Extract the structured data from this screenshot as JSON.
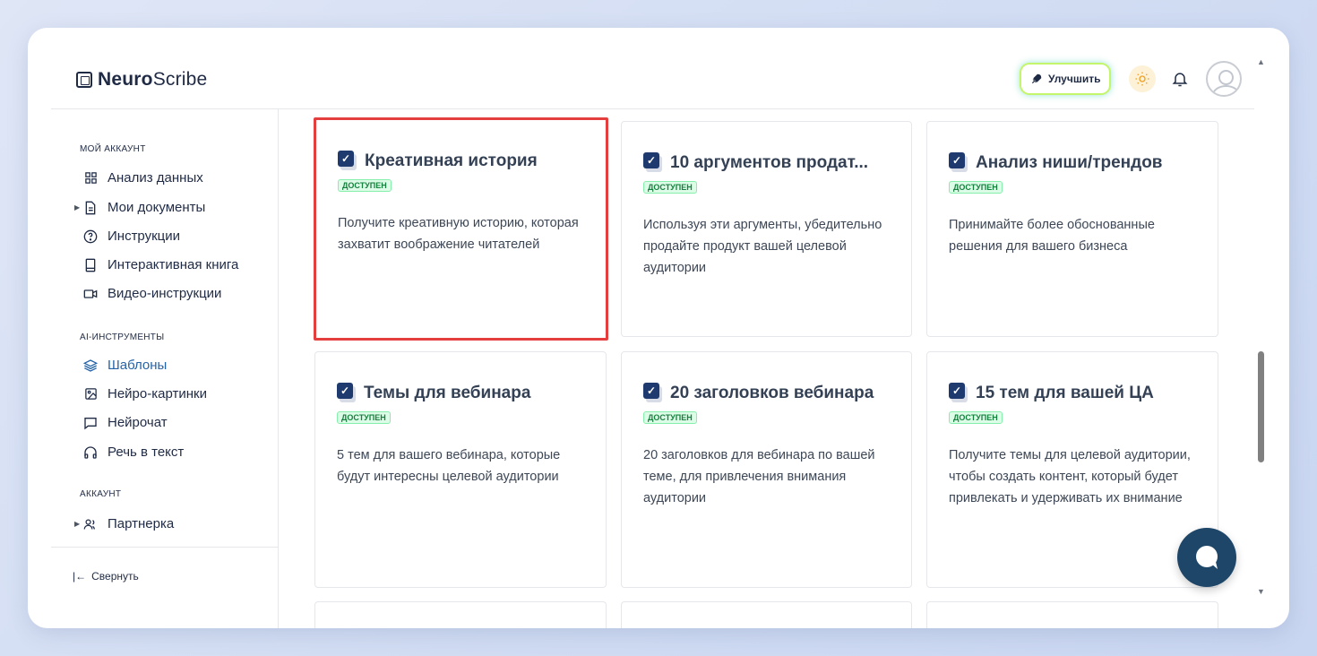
{
  "app": {
    "logo_bold": "Neuro",
    "logo_rest": "Scribe"
  },
  "header": {
    "upgrade_label": "Улучшить",
    "icons": [
      "rocket-icon",
      "sun-icon",
      "bell-icon",
      "user-avatar"
    ]
  },
  "sidebar": {
    "section_account": "МОЙ АККАУНТ",
    "items_account": [
      {
        "label": "Анализ данных",
        "icon": "grid-icon"
      },
      {
        "label": "Мои документы",
        "icon": "document-icon"
      },
      {
        "label": "Инструкции",
        "icon": "help-circle-icon"
      },
      {
        "label": "Интерактивная книга",
        "icon": "book-icon"
      },
      {
        "label": "Видео-инструкции",
        "icon": "video-icon"
      }
    ],
    "section_ai": "AI-ИНСТРУМЕНТЫ",
    "items_ai": [
      {
        "label": "Шаблоны",
        "icon": "layers-icon",
        "active": true
      },
      {
        "label": "Нейро-картинки",
        "icon": "image-icon"
      },
      {
        "label": "Нейрочат",
        "icon": "chat-icon"
      },
      {
        "label": "Речь в текст",
        "icon": "headphones-icon"
      }
    ],
    "section_billing": "АККАУНТ",
    "items_billing": [
      {
        "label": "Партнерка",
        "icon": "users-icon"
      }
    ],
    "collapse_label": "Свернуть"
  },
  "cards": [
    {
      "title": "Креативная история",
      "badge": "ДОСТУПЕН",
      "description": "Получите креативную историю, которая захватит воображение читателей",
      "selected": true
    },
    {
      "title": "10 аргументов продат...",
      "badge": "ДОСТУПЕН",
      "description": "Используя эти аргументы, убедительно продайте продукт вашей целевой аудитории"
    },
    {
      "title": "Анализ ниши/трендов",
      "badge": "ДОСТУПЕН",
      "description": "Принимайте более обоснованные решения для вашего бизнеса"
    },
    {
      "title": "Темы для вебинара",
      "badge": "ДОСТУПЕН",
      "description": "5 тем для вашего вебинара, которые будут интересны целевой аудитории"
    },
    {
      "title": "20 заголовков вебинара",
      "badge": "ДОСТУПЕН",
      "description": "20 заголовков для вебинара по вашей теме, для привлечения внимания аудитории"
    },
    {
      "title": "15 тем для вашей ЦА",
      "badge": "ДОСТУПЕН",
      "description": "Получите темы для целевой аудитории, чтобы создать контент, который будет привлекать и удерживать их внимание"
    }
  ],
  "colors": {
    "accent": "#2563a8",
    "selection_border": "#e53e3e",
    "badge_green": "#15803d",
    "chat_button": "#1e4668"
  }
}
